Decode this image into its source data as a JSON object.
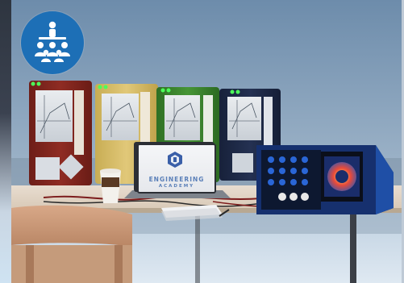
{
  "screen": {
    "brand_line1": "ENGINEERING",
    "brand_line2": "ACADEMY"
  },
  "badge": {
    "icon": "audience-group-icon",
    "color": "#1d6fb6"
  },
  "colors": {
    "device_red": "#8a2a22",
    "device_yellow": "#d8c06a",
    "device_green": "#3f8a2e",
    "device_navy": "#1f2a48",
    "tester_blue": "#1f4fa6"
  }
}
